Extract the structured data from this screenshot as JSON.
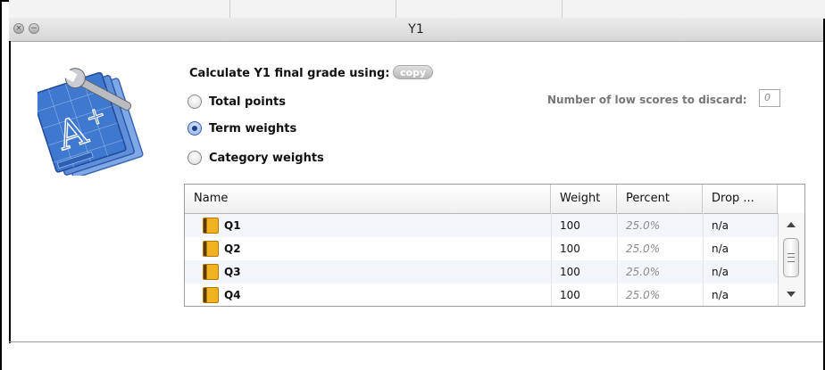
{
  "window": {
    "title": "Y1"
  },
  "options": {
    "calc_label": "Calculate Y1 final grade using:",
    "copy_label": "copy",
    "radios": [
      {
        "label": "Total points",
        "selected": false
      },
      {
        "label": "Term weights",
        "selected": true
      },
      {
        "label": "Category weights",
        "selected": false
      }
    ],
    "discard_label": "Number of low scores to discard:",
    "discard_value": "0"
  },
  "table": {
    "columns": [
      "Name",
      "Weight",
      "Percent",
      "Drop ..."
    ],
    "rows": [
      {
        "name": "Q1",
        "weight": "100",
        "percent": "25.0%",
        "drop": "n/a"
      },
      {
        "name": "Q2",
        "weight": "100",
        "percent": "25.0%",
        "drop": "n/a"
      },
      {
        "name": "Q3",
        "weight": "100",
        "percent": "25.0%",
        "drop": "n/a"
      },
      {
        "name": "Q4",
        "weight": "100",
        "percent": "25.0%",
        "drop": "n/a"
      }
    ]
  },
  "colors": {
    "selected_radio": "#1b3e8e",
    "folder": "#f1b21f",
    "row_alt": "#f2f5fa",
    "border": "#000000"
  },
  "icons": {
    "app_logo": "grade-tools-logo-icon",
    "close": "close-icon",
    "minimize": "minimize-icon",
    "folder": "folder-icon",
    "scroll_up": "scroll-up-icon",
    "scroll_down": "scroll-down-icon"
  }
}
